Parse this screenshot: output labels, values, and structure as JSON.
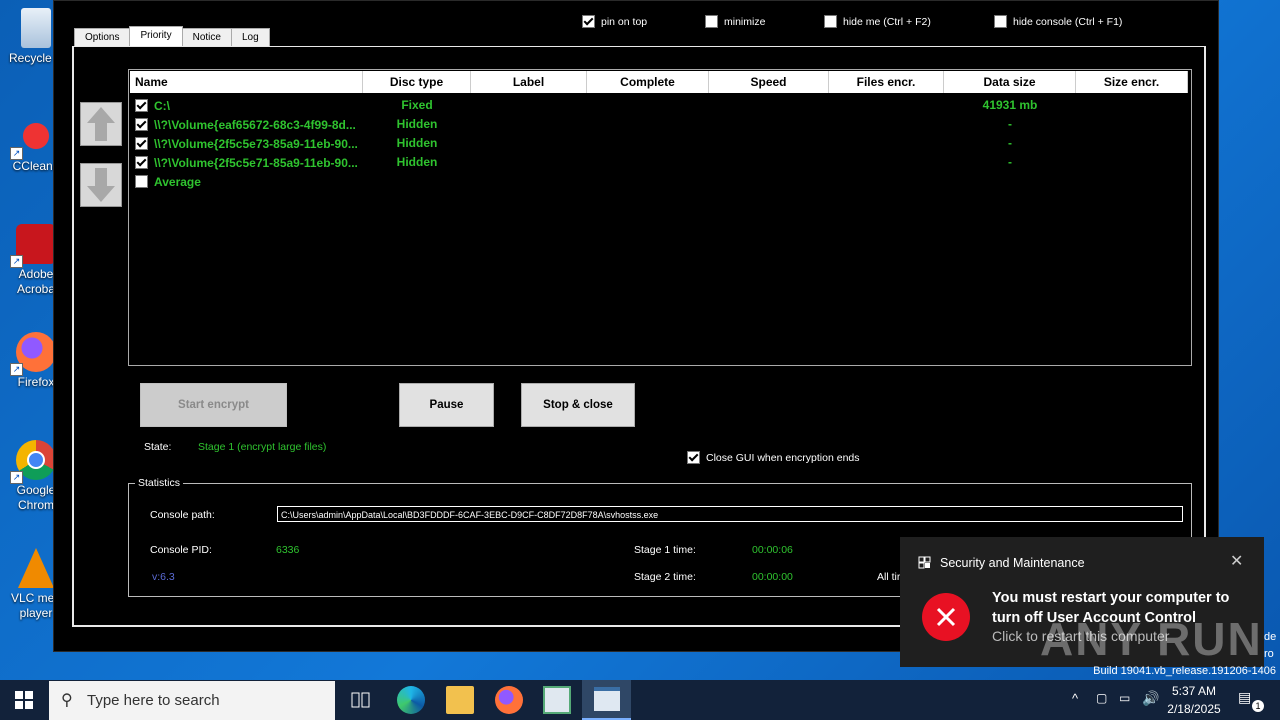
{
  "desktop": {
    "icons": [
      {
        "label": "Recycle B"
      },
      {
        "label": "CCleane"
      },
      {
        "label": "Adobe Acroba"
      },
      {
        "label": "Firefox"
      },
      {
        "label": "Google Chrom"
      },
      {
        "label": "VLC med player"
      }
    ]
  },
  "window": {
    "tabs": [
      "Options",
      "Priority",
      "Notice",
      "Log"
    ],
    "active_tab": "Priority",
    "top_options": [
      {
        "label": "pin on top",
        "checked": true
      },
      {
        "label": "minimize",
        "checked": false
      },
      {
        "label": "hide me (Ctrl + F2)",
        "checked": false
      },
      {
        "label": "hide console (Ctrl + F1)",
        "checked": false
      }
    ],
    "table": {
      "columns": [
        "Name",
        "Disc type",
        "Label",
        "Complete",
        "Speed",
        "Files encr.",
        "Data size",
        "Size encr."
      ],
      "rows": [
        {
          "checked": true,
          "name": "C:\\",
          "disc_type": "Fixed",
          "data_size": "41931 mb"
        },
        {
          "checked": true,
          "name": "\\\\?\\Volume{eaf65672-68c3-4f99-8d...",
          "disc_type": "Hidden",
          "data_size": "-"
        },
        {
          "checked": true,
          "name": "\\\\?\\Volume{2f5c5e73-85a9-11eb-90...",
          "disc_type": "Hidden",
          "data_size": "-"
        },
        {
          "checked": true,
          "name": "\\\\?\\Volume{2f5c5e71-85a9-11eb-90...",
          "disc_type": "Hidden",
          "data_size": "-"
        },
        {
          "checked": false,
          "name": "Average",
          "disc_type": "",
          "data_size": ""
        }
      ]
    },
    "buttons": {
      "start": "Start encrypt",
      "pause": "Pause",
      "stop": "Stop & close"
    },
    "state_label": "State:",
    "state_value": "Stage 1 (encrypt large files)",
    "close_gui": {
      "label": "Close GUI when encryption ends",
      "checked": true
    },
    "statistics": {
      "legend": "Statistics",
      "console_path_label": "Console path:",
      "console_path": "C:\\Users\\admin\\AppData\\Local\\BD3FDDDF-6CAF-3EBC-D9CF-C8DF72D8F78A\\svhostss.exe",
      "console_pid_label": "Console PID:",
      "console_pid": "6336",
      "version": "v:6.3",
      "stage1_label": "Stage 1 time:",
      "stage1_time": "00:00:06",
      "stage2_label": "Stage 2 time:",
      "stage2_time": "00:00:00",
      "all_time_label": "All tir"
    }
  },
  "toast": {
    "app": "Security and Maintenance",
    "title": "You must restart your computer to turn off User Account Control",
    "body": "Click to restart this computer"
  },
  "watermark": {
    "text": "ANY RUN",
    "side_text_1": "de",
    "side_text_2": "ro"
  },
  "build": "Build 19041.vb_release.191206-1406",
  "taskbar": {
    "search_placeholder": "Type here to search",
    "time": "5:37 AM",
    "date": "2/18/2025",
    "notification_count": "1"
  },
  "colors": {
    "green": "#2fc32f",
    "desktop_blue": "#0b6acb",
    "toast_error": "#e81123"
  }
}
